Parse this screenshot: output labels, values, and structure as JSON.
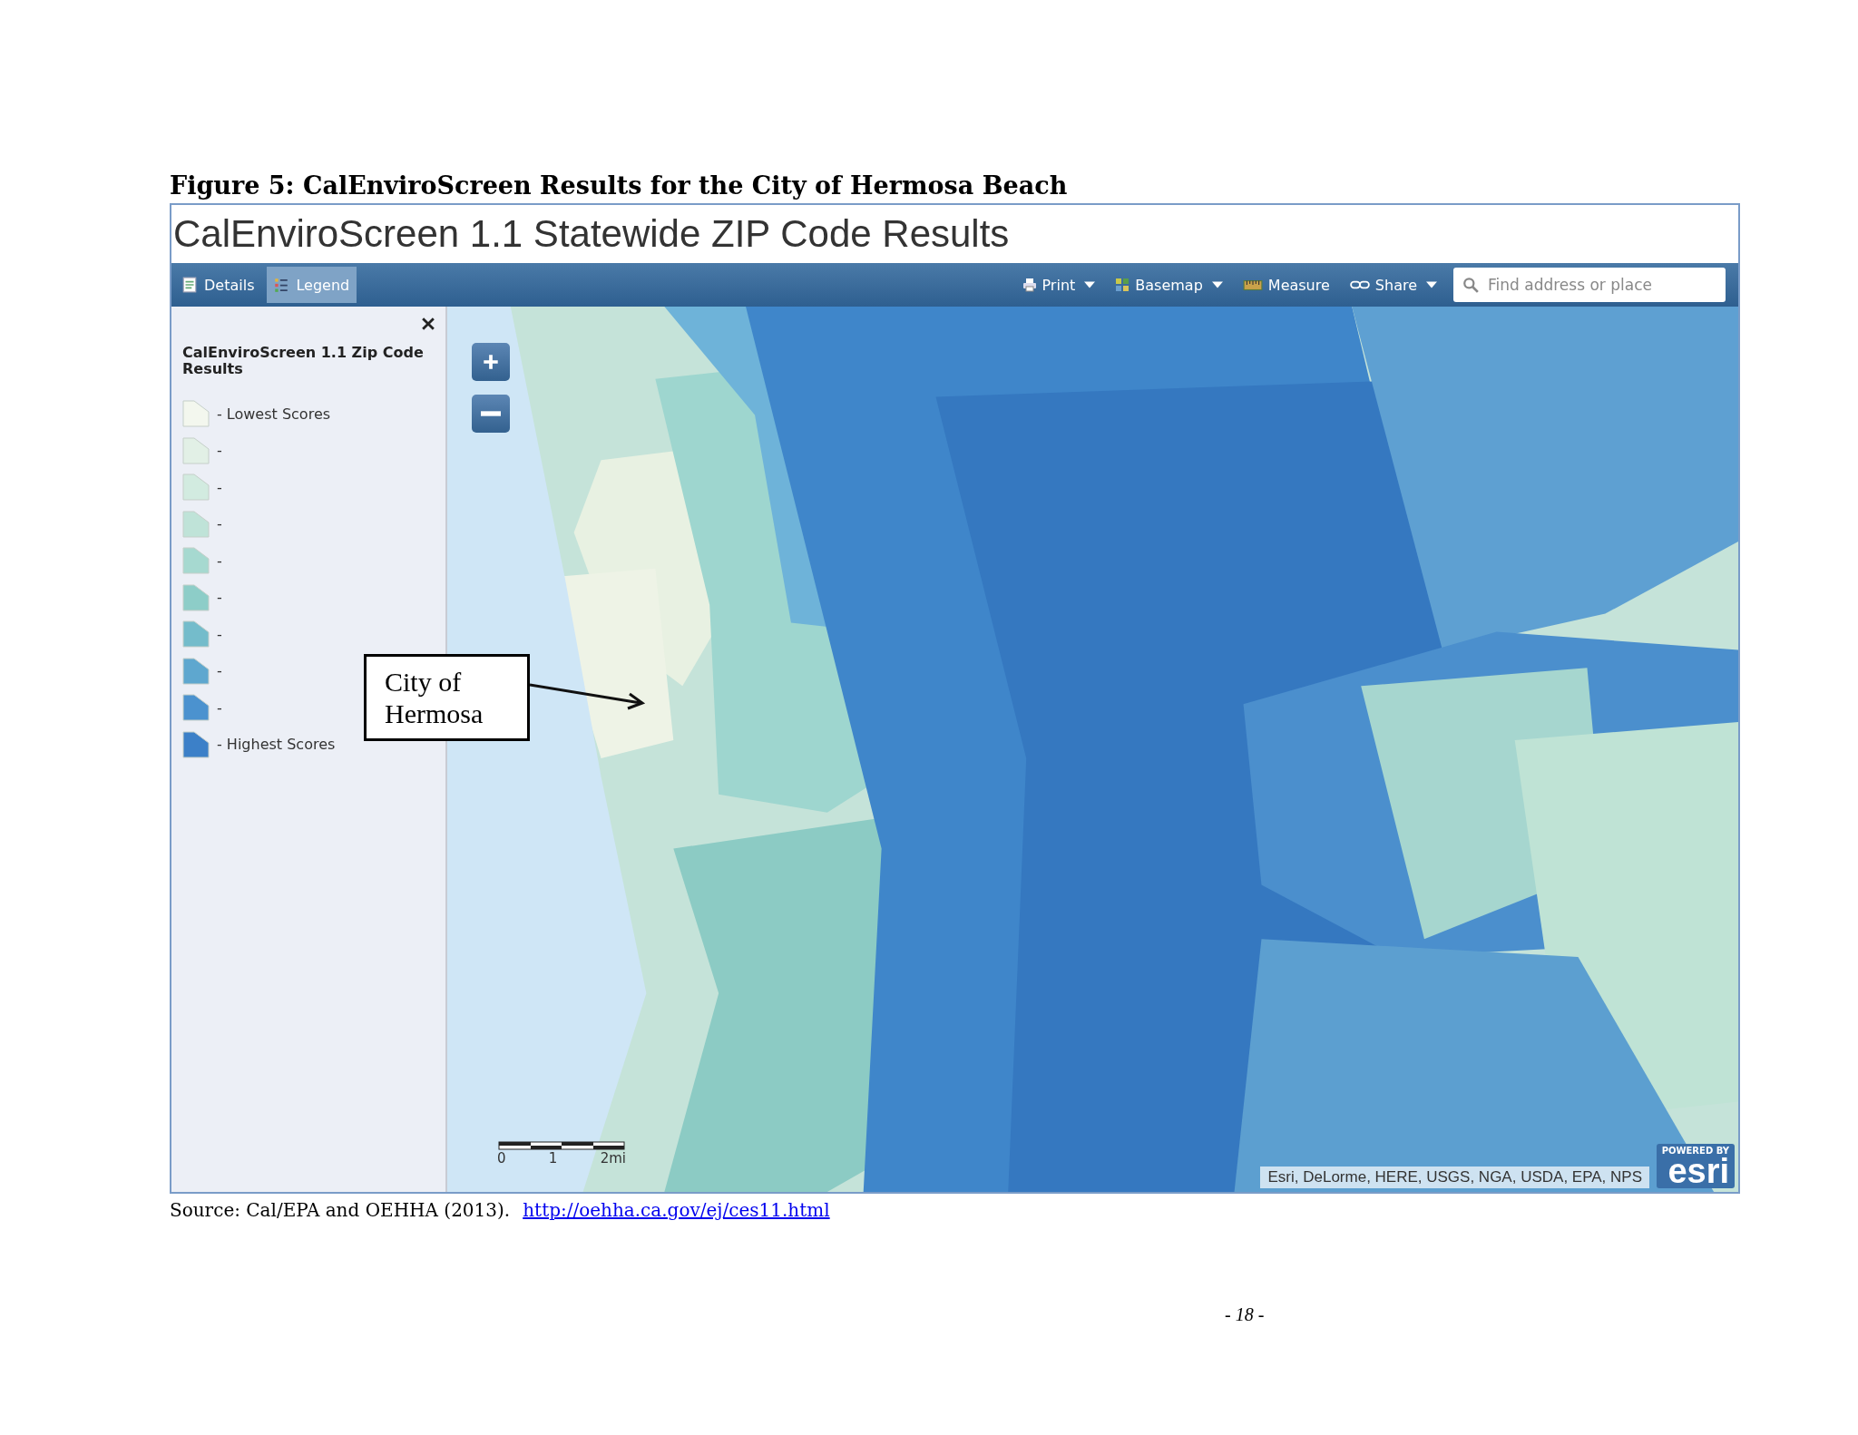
{
  "figure_caption": "Figure 5:  CalEnviroScreen Results for the City of Hermosa Beach",
  "app": {
    "title": "CalEnviroScreen 1.1 Statewide ZIP Code Results",
    "tabs": [
      {
        "label": "Details",
        "kind": "details",
        "selected": false
      },
      {
        "label": "Legend",
        "kind": "legend",
        "selected": true
      }
    ],
    "tools": [
      {
        "label": "Print",
        "kind": "print",
        "dropdown": true
      },
      {
        "label": "Basemap",
        "kind": "basemap",
        "dropdown": true
      },
      {
        "label": "Measure",
        "kind": "measure",
        "dropdown": false
      },
      {
        "label": "Share",
        "kind": "share",
        "dropdown": true
      }
    ],
    "search": {
      "placeholder": "Find address or place"
    },
    "legend": {
      "title": "CalEnviroScreen 1.1 Zip Code Results",
      "items": [
        {
          "label": "- Lowest Scores",
          "color": "#f3f7ee"
        },
        {
          "label": "-",
          "color": "#e2f0e6"
        },
        {
          "label": "-",
          "color": "#d2ebe0"
        },
        {
          "label": "-",
          "color": "#bfe3d8"
        },
        {
          "label": "-",
          "color": "#a6d9d0"
        },
        {
          "label": "-",
          "color": "#8dcdc8"
        },
        {
          "label": "-",
          "color": "#74bccb"
        },
        {
          "label": "-",
          "color": "#5ea7cf"
        },
        {
          "label": "-",
          "color": "#4b92cf"
        },
        {
          "label": "- Highest Scores",
          "color": "#3c80c8"
        }
      ]
    },
    "map": {
      "kind": "picture",
      "scale_labels": [
        "0",
        "1",
        "2mi"
      ],
      "attribution": "Esri, DeLorme, HERE, USGS, NGA, USDA, EPA, NPS",
      "logo_caption": "POWERED BY",
      "logo": "esri"
    },
    "callout": "City of Hermosa"
  },
  "source": {
    "text": "Source: Cal/EPA and OEHHA (2013).",
    "link": "http://oehha.ca.gov/ej/ces11.html"
  },
  "page_number": "- 18 -"
}
